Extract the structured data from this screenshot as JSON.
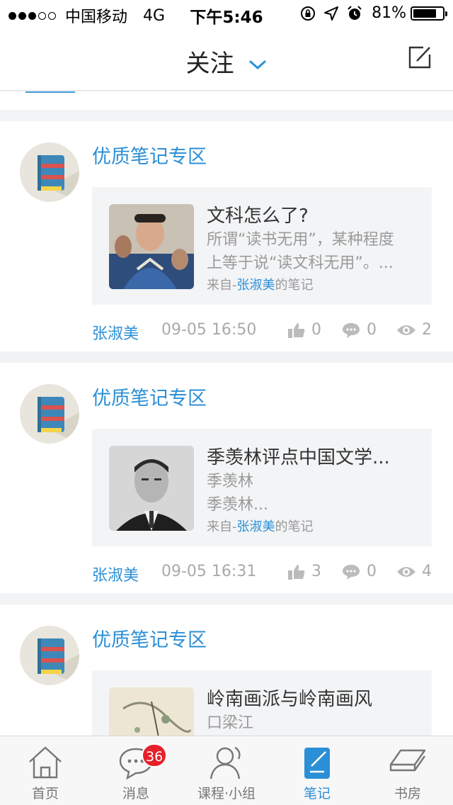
{
  "status_bar": {
    "carrier": "中国移动",
    "network": "4G",
    "time": "下午5:46",
    "battery": "81%",
    "battery_level": 0.81
  },
  "nav": {
    "title": "关注",
    "compose_icon": "compose-icon"
  },
  "cards": [
    {
      "tag": "优质笔记专区",
      "title": "文科怎么了?",
      "body": [
        "所谓“读书无用”，某种程度",
        "上等于说“读文科无用”。..."
      ],
      "source_prefix": "来自-",
      "source_author": "张淑美",
      "source_suffix": "的笔记",
      "author": "张淑美",
      "date": "09-05 16:50",
      "likes": "0",
      "comments": "0",
      "views": "2"
    },
    {
      "tag": "优质笔记专区",
      "title": "季羡林评点中国文学...",
      "body": [
        "季羡林",
        "季羡林..."
      ],
      "source_prefix": "来自-",
      "source_author": "张淑美",
      "source_suffix": "的笔记",
      "author": "张淑美",
      "date": "09-05 16:31",
      "likes": "3",
      "comments": "0",
      "views": "4"
    },
    {
      "tag": "优质笔记专区",
      "title": "岭南画派与岭南画风",
      "body": [
        "口梁江"
      ]
    }
  ],
  "tabs": [
    {
      "label": "首页",
      "icon": "home-icon"
    },
    {
      "label": "消息",
      "icon": "message-icon",
      "badge": "36"
    },
    {
      "label": "课程·小组",
      "icon": "course-group-icon"
    },
    {
      "label": "笔记",
      "icon": "note-icon",
      "active": true
    },
    {
      "label": "书房",
      "icon": "study-icon"
    }
  ],
  "colors": {
    "accent": "#2b8fd6",
    "badge": "#e5202b",
    "background": "#f2f3f5"
  }
}
